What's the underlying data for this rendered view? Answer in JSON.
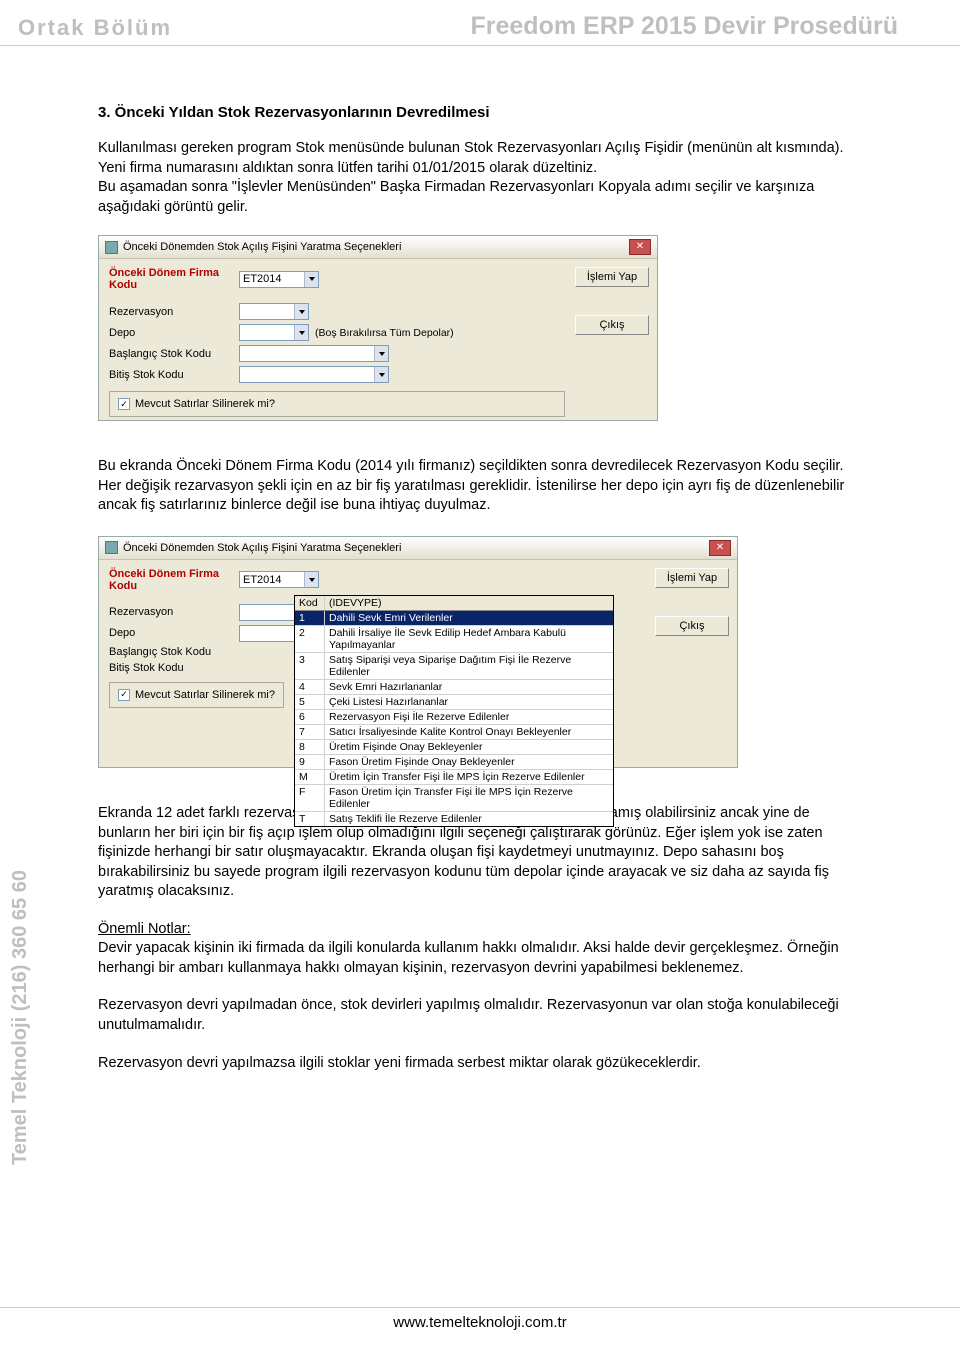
{
  "header": {
    "left": "Ortak Bölüm",
    "right": "Freedom ERP 2015 Devir Prosedürü"
  },
  "section_title": "3. Önceki Yıldan Stok Rezervasyonlarının Devredilmesi",
  "para1": "Kullanılması gereken program Stok menüsünde bulunan Stok Rezervasyonları Açılış Fişidir (menünün alt kısmında). Yeni firma numarasını aldıktan sonra lütfen tarihi 01/01/2015 olarak düzeltiniz.",
  "para2": "Bu aşamadan sonra \"İşlevler Menüsünden\" Başka Firmadan Rezervasyonları Kopyala adımı seçilir ve karşınıza aşağıdaki görüntü gelir.",
  "dialog": {
    "title": "Önceki Dönemden Stok Açılış Fişini Yaratma Seçenekleri",
    "firm_label": "Önceki Dönem Firma Kodu",
    "firm_value": "ET2014",
    "rows": {
      "rezervasyon": "Rezervasyon",
      "depo": "Depo",
      "depo_hint": "(Boş Bırakılırsa Tüm Depolar)",
      "baslangic": "Başlangıç Stok Kodu",
      "bitis": "Bitiş Stok Kodu"
    },
    "checkbox": "Mevcut Satırlar Silinerek mi?",
    "btn_run": "İşlemi Yap",
    "btn_exit": "Çıkış"
  },
  "para3": "Bu ekranda Önceki Dönem Firma Kodu (2014 yılı firmanız) seçildikten sonra devredilecek Rezervasyon Kodu seçilir. Her değişik rezarvasyon şekli için en az bir fiş yaratılması gereklidir. İstenilirse her depo için ayrı fiş de düzenlenebilir ancak fiş satırlarınız binlerce değil ise buna ihtiyaç duyulmaz.",
  "dropdown": {
    "head": {
      "c1": "Kod",
      "c2": "(IDEVYPE)"
    },
    "rows": [
      {
        "c1": "1",
        "c2": "Dahili Sevk Emri Verilenler",
        "sel": true
      },
      {
        "c1": "2",
        "c2": "Dahili İrsaliye İle Sevk Edilip Hedef Ambara Kabulü Yapılmayanlar"
      },
      {
        "c1": "3",
        "c2": "Satış Siparişi veya Siparişe Dağıtım Fişi İle Rezerve Edilenler"
      },
      {
        "c1": "4",
        "c2": "Sevk Emri Hazırlananlar"
      },
      {
        "c1": "5",
        "c2": "Çeki Listesi Hazırlananlar"
      },
      {
        "c1": "6",
        "c2": "Rezervasyon Fişi İle Rezerve Edilenler"
      },
      {
        "c1": "7",
        "c2": "Satıcı İrsaliyesinde Kalite Kontrol Onayı Bekleyenler"
      },
      {
        "c1": "8",
        "c2": "Üretim Fişinde Onay Bekleyenler"
      },
      {
        "c1": "9",
        "c2": "Fason Üretim Fişinde Onay Bekleyenler"
      },
      {
        "c1": "M",
        "c2": "Üretim İçin Transfer Fişi İle MPS İçin Rezerve Edilenler"
      },
      {
        "c1": "F",
        "c2": "Fason Üretim İçin Transfer Fişi İle MPS İçin Rezerve Edilenler"
      },
      {
        "c1": "T",
        "c2": "Satış Teklifi İle Rezerve Edilenler"
      }
    ]
  },
  "para4": "Ekranda 12 adet farklı rezervasyon türü görmektesiniz, bunların hepsini kullanmamış olabilirsiniz ancak yine de bunların her biri için bir fiş açıp işlem olup olmadığını ilgili seçeneği çalıştırarak görünüz. Eğer işlem yok ise zaten fişinizde herhangi bir satır oluşmayacaktır. Ekranda oluşan fişi kaydetmeyi unutmayınız. Depo sahasını boş bırakabilirsiniz bu sayede program ilgili rezervasyon kodunu tüm depolar içinde arayacak ve siz daha az sayıda fiş yaratmış olacaksınız.",
  "notes_title": "Önemli Notlar:",
  "para5": "Devir yapacak kişinin iki firmada da ilgili konularda kullanım hakkı olmalıdır. Aksi halde devir gerçekleşmez. Örneğin herhangi bir ambarı kullanmaya hakkı olmayan kişinin, rezervasyon devrini yapabilmesi beklenemez.",
  "para6": "Rezervasyon devri yapılmadan önce, stok devirleri yapılmış olmalıdır. Rezervasyonun var olan stoğa konulabileceği unutulmamalıdır.",
  "para7": "Rezervasyon devri yapılmazsa ilgili stoklar yeni firmada serbest miktar olarak gözükeceklerdir.",
  "side_text": "Temel Teknoloji (216) 360 65 60",
  "footer": "www.temelteknoloji.com.tr"
}
